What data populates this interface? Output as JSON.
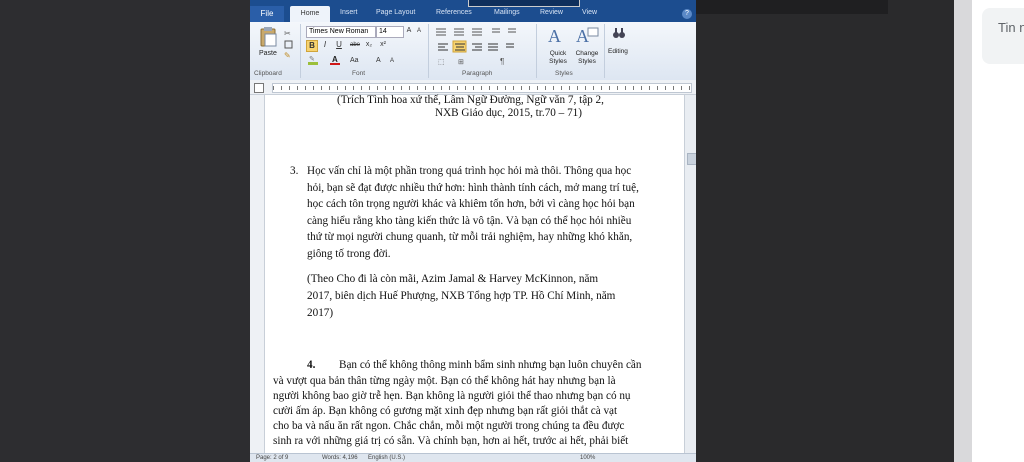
{
  "chat": {
    "text": "Tin n"
  },
  "word": {
    "tabs": [
      "File",
      "Home",
      "Insert",
      "Page Layout",
      "References",
      "Mailings",
      "Review",
      "View"
    ],
    "help": "?",
    "ribbon": {
      "paste": "Paste",
      "clipboard": "Clipboard",
      "font_name": "Times New Roman",
      "font_size": "14",
      "font_group": "Font",
      "paragraph_group": "Paragraph",
      "quick_styles": "Quick Styles",
      "change_styles": "Change Styles",
      "styles_group": "Styles",
      "editing": "Editing",
      "bold": "B",
      "italic": "I",
      "underline": "U",
      "strike": "abe",
      "subscript": "x₂",
      "superscript": "x²"
    },
    "doc": {
      "cite1_line1": "(Trích Tình hoa xứ thế, Lâm Ngữ Đường, Ngữ văn 7, tập 2,",
      "cite1_line2": "NXB Giáo dục, 2015, tr.70 – 71)",
      "item3_num": "3.",
      "item3_lines": [
        "Học vấn chỉ là một phần trong quá trình học hỏi mà thôi. Thông qua học",
        "hỏi, bạn sẽ đạt được nhiều thứ hơn: hình thành tính cách, mở mang trí tuệ,",
        "học cách tôn trọng người khác và khiêm tốn hơn, bởi vì càng học hỏi bạn",
        "càng hiểu rằng kho tàng kiến thức là vô tận. Và bạn có thể học hỏi nhiều",
        "thứ từ mọi người chung quanh, từ mỗi trải nghiệm, hay những khó khăn,",
        "giông tố trong đời."
      ],
      "cite2_lines": [
        "(Theo Cho đi là còn mãi, Azim Jamal & Harvey McKinnon, năm",
        "2017, biên dịch Huế Phượng, NXB Tổng hợp TP. Hồ Chí Minh, năm",
        "2017)"
      ],
      "item4_num": "4.",
      "item4_first": "Bạn có thể không thông minh bẩm sinh nhưng bạn luôn chuyên cần",
      "item4_lines": [
        "và vượt qua bản thân từng ngày một. Bạn có thể không hát hay nhưng bạn là",
        "người không bao giờ trễ hẹn. Bạn không là người giỏi thể thao nhưng bạn có nụ",
        "cười ấm áp. Bạn không có gương mặt xinh đẹp nhưng bạn rất giỏi thắt cà vạt",
        "cho ba và nấu ăn rất ngon. Chắc chắn, mỗi một người trong chúng ta đều được",
        "sinh ra với những giá trị có sẵn. Và chính bạn, hơn ai hết, trước ai hết, phải biết"
      ]
    },
    "status": {
      "page": "Page: 2 of 9",
      "words": "Words: 4,196",
      "language": "English (U.S.)",
      "zoom": "100%"
    }
  }
}
